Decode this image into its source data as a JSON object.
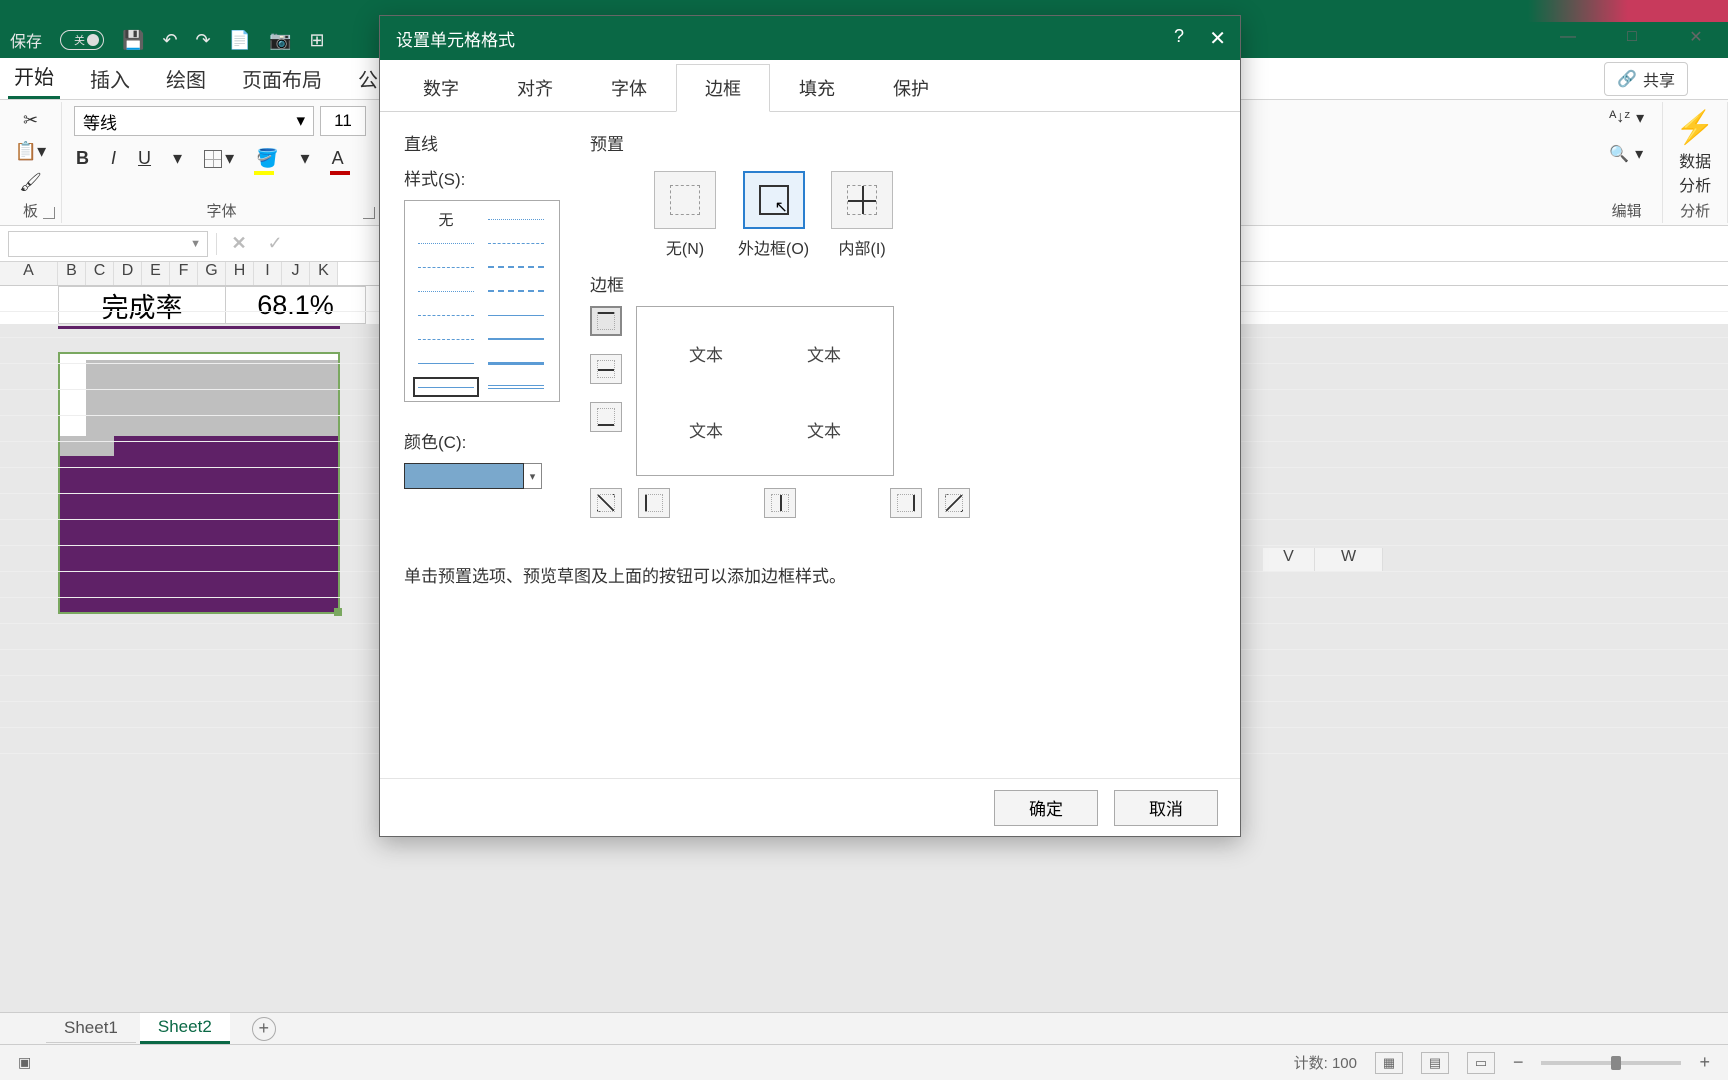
{
  "titlebar": {
    "autosave_label": "保存",
    "autosave_toggle_state": "关"
  },
  "window_controls": {
    "minimize": "—",
    "maximize": "□",
    "close": "✕"
  },
  "ribbon_tabs": [
    "开始",
    "插入",
    "绘图",
    "页面布局",
    "公式"
  ],
  "share_label": "共享",
  "font": {
    "name": "等线",
    "size": "11",
    "group_label": "字体"
  },
  "clipboard_group_label": "板",
  "edit_group": {
    "label": "编辑",
    "sort_label": "A↓Z",
    "find_icon": "🔍"
  },
  "analyze": {
    "label_line1": "数据",
    "label_line2": "分析",
    "group_label": "分析"
  },
  "columns": [
    "A",
    "B",
    "C",
    "D",
    "E",
    "F",
    "G",
    "H",
    "I",
    "J",
    "K"
  ],
  "columns_right": [
    "V",
    "W"
  ],
  "data_cells": {
    "label": "完成率",
    "value": "68.1%"
  },
  "sheet_tabs": [
    "Sheet1",
    "Sheet2"
  ],
  "status": {
    "count_label": "计数:",
    "count_value": "100"
  },
  "dialog": {
    "title": "设置单元格格式",
    "tabs": [
      "数字",
      "对齐",
      "字体",
      "边框",
      "填充",
      "保护"
    ],
    "line_section": "直线",
    "style_label": "样式(S):",
    "style_none": "无",
    "color_label": "颜色(C):",
    "preset_section": "预置",
    "preset_none": "无(N)",
    "preset_outline": "外边框(O)",
    "preset_inside": "内部(I)",
    "border_section": "边框",
    "sample_text": "文本",
    "hint": "单击预置选项、预览草图及上面的按钮可以添加边框样式。",
    "ok": "确定",
    "cancel": "取消",
    "help": "?",
    "close": "✕"
  },
  "chart_data": {
    "type": "bar",
    "title": "完成率",
    "value_label": "68.1%",
    "total_cells": 100,
    "filled_cells": 68,
    "percent": 68.1,
    "fill_color": "#5f2167",
    "empty_color": "#bfbfbf"
  }
}
